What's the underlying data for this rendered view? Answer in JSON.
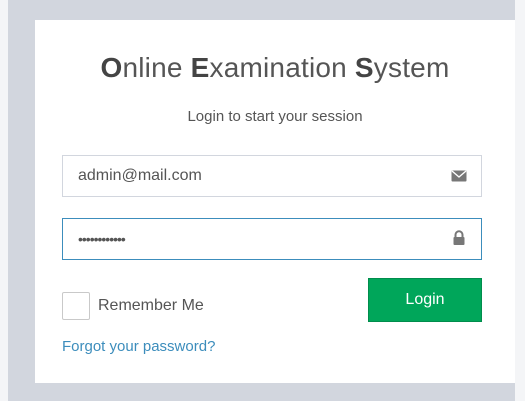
{
  "page": {
    "background_color": "#d2d6de"
  },
  "login_box": {
    "title_segments": [
      {
        "text": "O",
        "emphasis": true
      },
      {
        "text": "nline ",
        "emphasis": false
      },
      {
        "text": "E",
        "emphasis": true
      },
      {
        "text": "xamination ",
        "emphasis": false
      },
      {
        "text": "S",
        "emphasis": true
      },
      {
        "text": "ystem",
        "emphasis": false
      }
    ],
    "subtitle": "Login to start your session",
    "email": {
      "value": "admin@mail.com",
      "icon": "envelope-icon"
    },
    "password": {
      "value": "••••••••••••",
      "icon": "lock-icon",
      "focused": true
    },
    "remember_me": {
      "label": "Remember Me",
      "checked": false
    },
    "login_button": {
      "label": "Login",
      "color": "#00a65a"
    },
    "forgot_password_link": "Forgot your password?",
    "accent_color": "#3c8dbc"
  }
}
